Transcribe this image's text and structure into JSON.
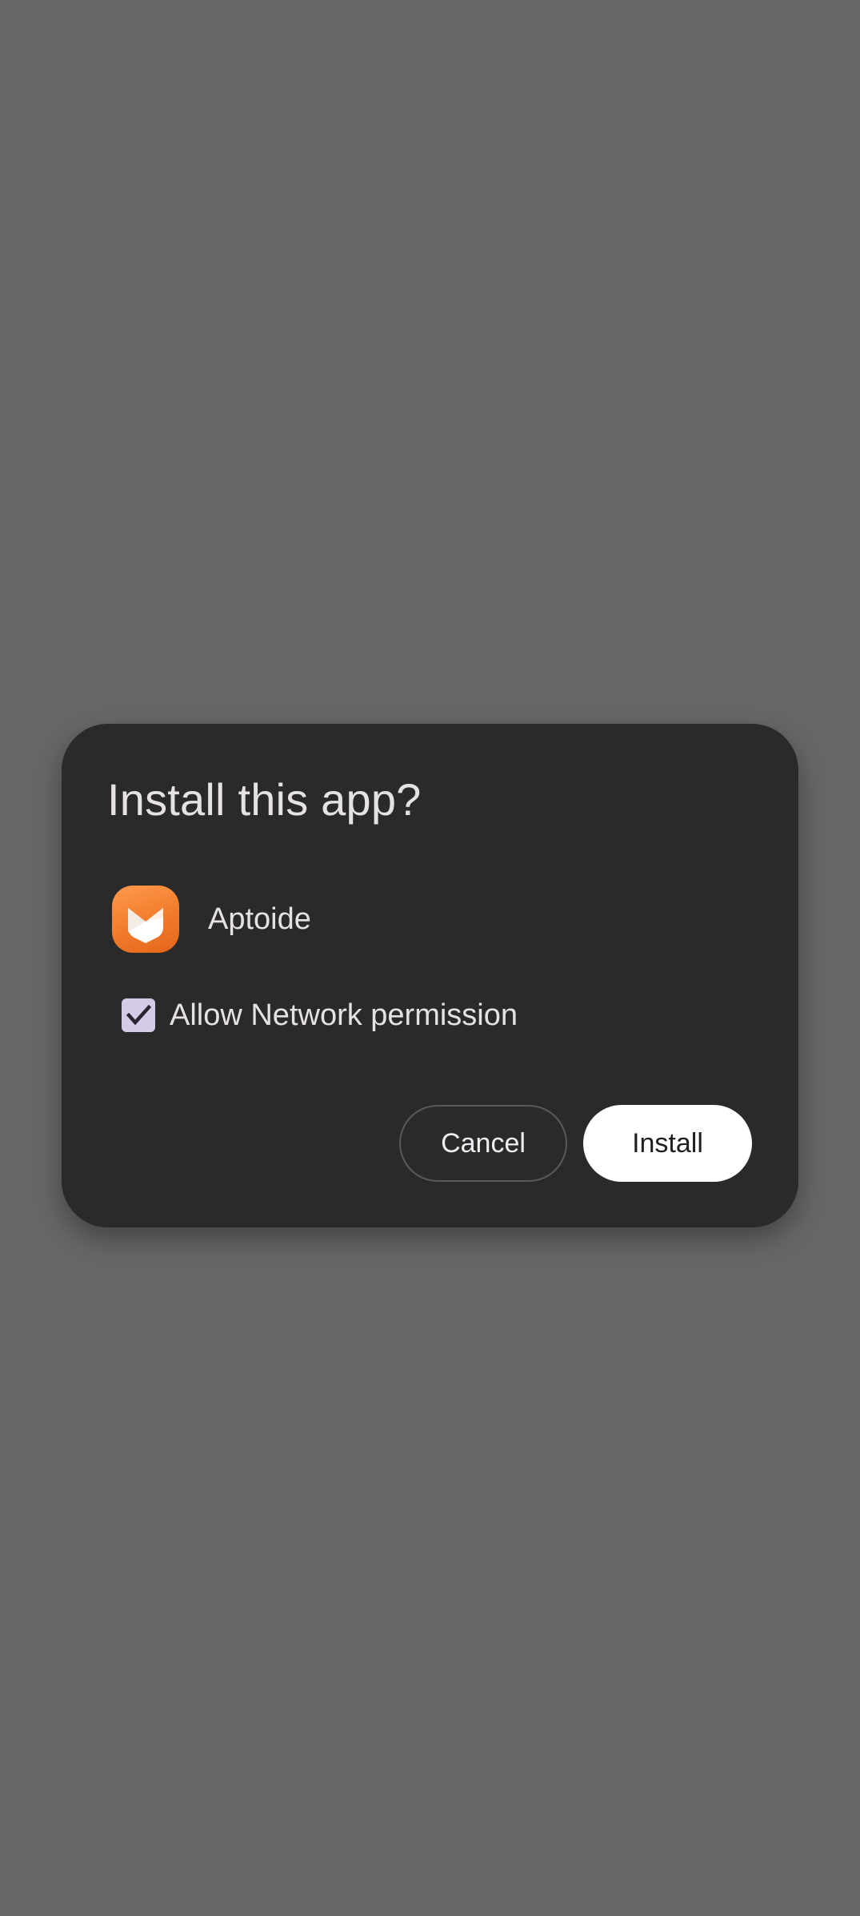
{
  "dialog": {
    "title": "Install this app?",
    "app": {
      "name": "Aptoide",
      "icon": "aptoide-app-icon"
    },
    "permission": {
      "label": "Allow Network permission",
      "checked": true
    },
    "buttons": {
      "cancel_label": "Cancel",
      "install_label": "Install"
    }
  },
  "colors": {
    "scrim": "#676767",
    "dialog_background": "#2a2a2b",
    "text_primary": "#e6e1e5",
    "checkbox_fill": "#d6cbe6",
    "install_button_background": "#ffffff",
    "app_icon_orange": "#f07b2a"
  }
}
